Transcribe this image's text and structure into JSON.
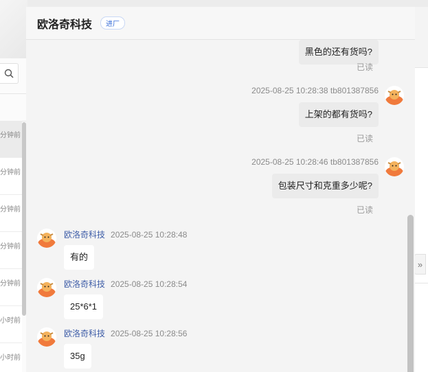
{
  "sidebar": {
    "items": [
      {
        "time": "分钟前"
      },
      {
        "time": "分钟前"
      },
      {
        "time": "分钟前"
      },
      {
        "time": "分钟前"
      },
      {
        "time": "分钟前"
      },
      {
        "time": "小时前"
      },
      {
        "time": "小时前"
      }
    ]
  },
  "chat": {
    "title": "欧洛奇科技",
    "tag": "进厂",
    "read_label": "已读",
    "messages": [
      {
        "dir": "out",
        "meta": "",
        "text": "黑色的还有货吗?"
      },
      {
        "dir": "out",
        "meta": "2025-08-25 10:28:38  tb801387856",
        "text": "上架的都有货吗?"
      },
      {
        "dir": "out",
        "meta": "2025-08-25 10:28:46  tb801387856",
        "text": "包装尺寸和克重多少呢?"
      },
      {
        "dir": "in",
        "nick": "欧洛奇科技",
        "time": "2025-08-25 10:28:48",
        "text": "有的"
      },
      {
        "dir": "in",
        "nick": "欧洛奇科技",
        "time": "2025-08-25 10:28:54",
        "text": "25*6*1"
      },
      {
        "dir": "in",
        "nick": "欧洛奇科技",
        "time": "2025-08-25 10:28:56",
        "text": "35g"
      }
    ]
  },
  "colors": {
    "accent": "#3b6fd8",
    "avatar": "#f07a3c",
    "nick": "#3f5ea8"
  },
  "icons": {
    "search": "search-icon",
    "collapse": "double-chevron-right-icon"
  }
}
